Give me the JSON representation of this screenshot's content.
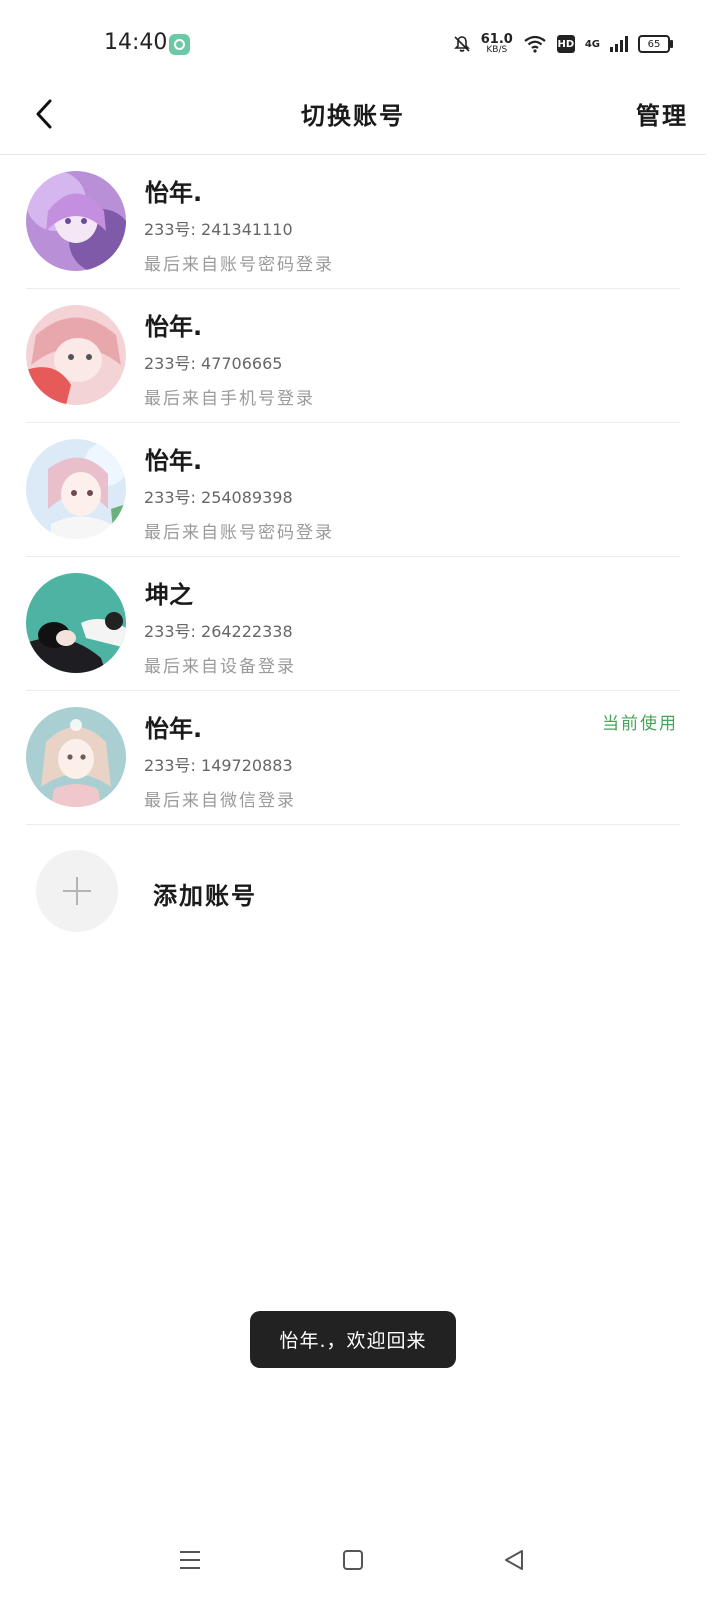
{
  "status_bar": {
    "time": "14:40",
    "net_speed_value": "61.0",
    "net_speed_unit": "KB/S",
    "hd_label": "HD",
    "network_type": "4G",
    "battery": "65"
  },
  "header": {
    "title": "切换账号",
    "manage_label": "管理"
  },
  "accounts": [
    {
      "name": "怡年.",
      "id_text": "233号: 241341110",
      "login_text": "最后来自账号密码登录",
      "current_label": ""
    },
    {
      "name": "怡年.",
      "id_text": "233号: 47706665",
      "login_text": "最后来自手机号登录",
      "current_label": ""
    },
    {
      "name": "怡年.",
      "id_text": "233号: 254089398",
      "login_text": "最后来自账号密码登录",
      "current_label": ""
    },
    {
      "name": "坤之",
      "id_text": "233号: 264222338",
      "login_text": "最后来自设备登录",
      "current_label": ""
    },
    {
      "name": "怡年.",
      "id_text": "233号: 149720883",
      "login_text": "最后来自微信登录",
      "current_label": "当前使用"
    }
  ],
  "add_account_label": "添加账号",
  "toast_text": "怡年.，欢迎回来",
  "colors": {
    "current_tag": "#4aa35a",
    "toast_bg": "#222222"
  },
  "icons": {
    "back": "chevron-left-icon",
    "add": "plus-icon",
    "nav_menu": "menu-icon",
    "nav_home": "square-icon",
    "nav_back": "triangle-back-icon"
  }
}
